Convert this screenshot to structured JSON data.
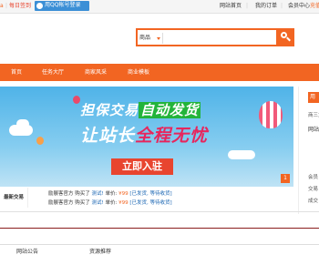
{
  "topbar": {
    "signin": "每日签到",
    "qq_login": "用QQ帐号登录",
    "links": [
      "网站首页",
      "我的订单",
      "会员中心",
      "充值"
    ]
  },
  "search": {
    "category": "商品"
  },
  "nav": {
    "items": [
      "首页",
      "任务大厅",
      "商家风采",
      "商业模板"
    ]
  },
  "banner": {
    "headline_part1": "担保交易",
    "headline_part2": "自动发货",
    "slogan_part1": "让站长",
    "slogan_part2": "全程无忧",
    "cta": "立即入驻",
    "page_number": "1"
  },
  "right_panel": {
    "button": "用",
    "sub": "商三大",
    "notice": "网站公",
    "member_items": [
      "会员",
      "交易",
      "成交"
    ]
  },
  "ticker": {
    "label": "最新交易",
    "rows": [
      {
        "user": "励展客官方",
        "action": "购买了",
        "item": "测试!",
        "price_label": "单价:",
        "price": "¥99",
        "status": "[已发货, 等待收货]"
      },
      {
        "user": "励展客官方",
        "action": "购买了",
        "item": "测试!",
        "price_label": "单价:",
        "price": "¥99",
        "status": "[已发货, 等待收货]"
      }
    ]
  },
  "bottom_tabs": [
    "网站公告",
    "资源推荐"
  ],
  "colors": {
    "accent": "#f26522",
    "qq_blue": "#3b8fd6"
  }
}
